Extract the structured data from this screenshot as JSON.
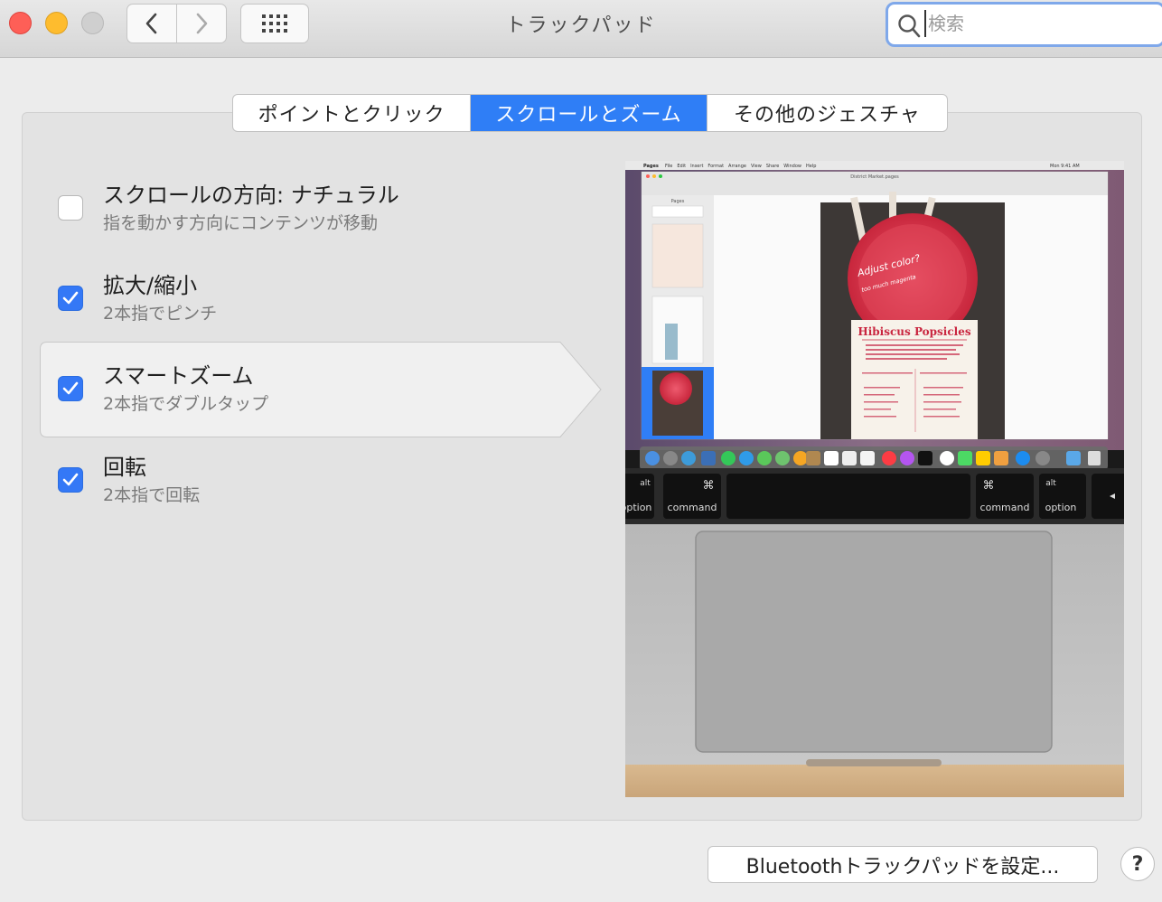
{
  "window": {
    "title": "トラックパッド"
  },
  "search": {
    "placeholder": "検索",
    "value": ""
  },
  "tabs": [
    {
      "label": "ポイントとクリック",
      "selected": false
    },
    {
      "label": "スクロールとズーム",
      "selected": true
    },
    {
      "label": "その他のジェスチャ",
      "selected": false
    }
  ],
  "options": [
    {
      "title": "スクロールの方向: ナチュラル",
      "subtitle": "指を動かす方向にコンテンツが移動",
      "checked": false
    },
    {
      "title": "拡大/縮小",
      "subtitle": "2本指でピンチ",
      "checked": true
    },
    {
      "title": "スマートズーム",
      "subtitle": "2本指でダブルタップ",
      "checked": true,
      "highlighted": true
    },
    {
      "title": "回転",
      "subtitle": "2本指で回転",
      "checked": true
    }
  ],
  "preview": {
    "screen_menu": [
      "Pages",
      "File",
      "Edit",
      "Insert",
      "Format",
      "Arrange",
      "View",
      "Share",
      "Window",
      "Help"
    ],
    "clock": "Mon 9:41 AM",
    "document_title": "District Market.pages",
    "poster_title": "Hibiscus Popsicles",
    "poster_note": "Adjust color?",
    "poster_note2": "too much magenta",
    "sidebar_label": "Pages",
    "keys": {
      "alt": "alt",
      "option": "option",
      "command": "command",
      "cmd_symbol": "⌘"
    }
  },
  "footer": {
    "bluetooth_button": "Bluetoothトラックパッドを設定...",
    "help_button": "?"
  },
  "colors": {
    "accent": "#2f7ef6",
    "checkbox": "#3478f6",
    "close": "#fe5f57",
    "minimize": "#febc2e"
  }
}
